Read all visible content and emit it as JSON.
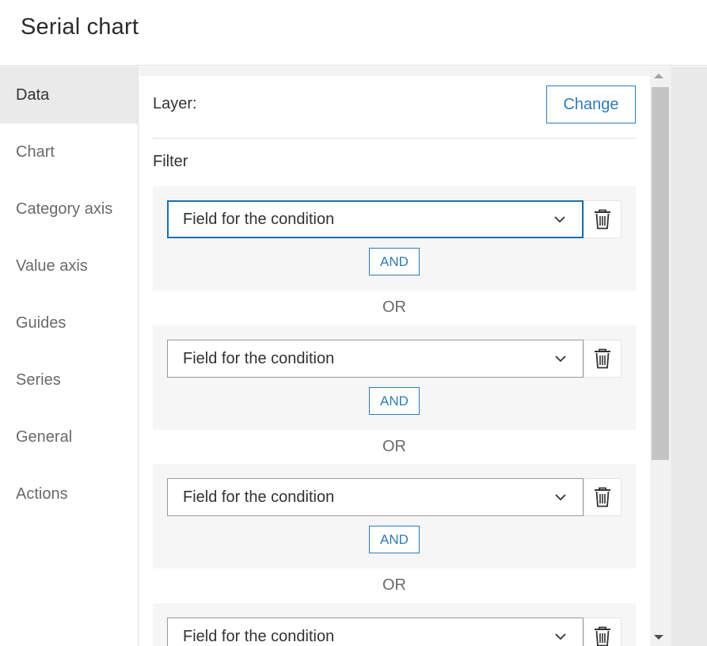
{
  "window": {
    "title": "Serial chart"
  },
  "sidebar": {
    "items": [
      {
        "label": "Data",
        "active": true
      },
      {
        "label": "Chart"
      },
      {
        "label": "Category axis"
      },
      {
        "label": "Value axis"
      },
      {
        "label": "Guides"
      },
      {
        "label": "Series"
      },
      {
        "label": "General"
      },
      {
        "label": "Actions"
      }
    ]
  },
  "data_panel": {
    "layer_label": "Layer:",
    "change_label": "Change",
    "filter_label": "Filter",
    "conditions": [
      {
        "field_placeholder": "Field for the condition",
        "and_label": "AND",
        "focused": true
      },
      {
        "field_placeholder": "Field for the condition",
        "and_label": "AND"
      },
      {
        "field_placeholder": "Field for the condition",
        "and_label": "AND"
      },
      {
        "field_placeholder": "Field for the condition"
      }
    ],
    "or_label": "OR"
  },
  "icons": {
    "delete": "trash-icon",
    "dropdown": "chevron-down-icon",
    "scroll_up": "arrow-up-icon",
    "scroll_down": "arrow-down-icon"
  },
  "colors": {
    "accent": "#2f7bb5",
    "focus": "#1a6fae"
  }
}
